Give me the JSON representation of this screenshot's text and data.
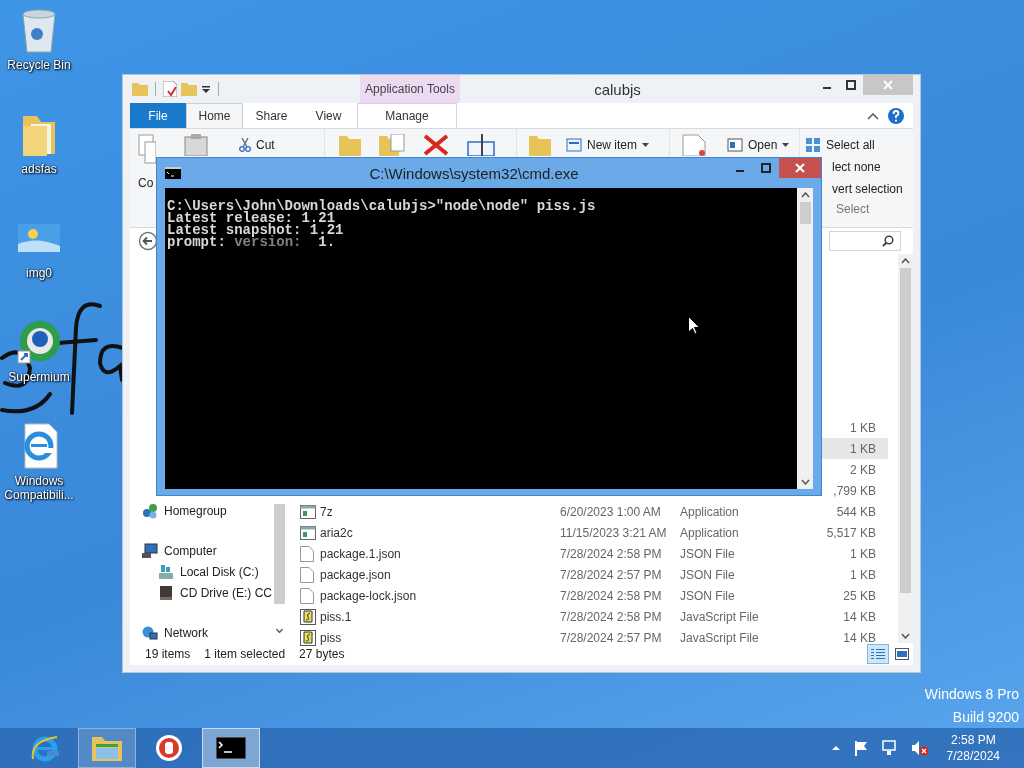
{
  "desktop": {
    "icons": [
      {
        "label": "Recycle Bin",
        "kind": "recycle"
      },
      {
        "label": "adsfas",
        "kind": "folder"
      },
      {
        "label": "img0",
        "kind": "image"
      },
      {
        "label": "Supermium",
        "kind": "browser"
      },
      {
        "label": "Windows Compatibili...",
        "kind": "ie"
      }
    ],
    "watermark": [
      "Windows 8 Pro",
      "Build 9200"
    ]
  },
  "explorer": {
    "title": "calubjs",
    "context_tab": "Application Tools",
    "tabs": [
      {
        "label": "File",
        "kind": "file",
        "selected": false
      },
      {
        "label": "Home",
        "kind": "tab",
        "selected": true
      },
      {
        "label": "Share",
        "kind": "tab",
        "selected": false
      },
      {
        "label": "View",
        "kind": "tab",
        "selected": false
      },
      {
        "label": "Manage",
        "kind": "context",
        "selected": false
      }
    ],
    "ribbon": {
      "copy": "Co",
      "cut": "Cut",
      "new_item": "New item",
      "open": "Open",
      "select_all": "Select all",
      "select_none": "lect none",
      "invert_selection": "vert selection",
      "select_group": "Select"
    },
    "nav": [
      {
        "label": "Homegroup",
        "kind": "homegroup"
      },
      {
        "label": "Computer",
        "kind": "computer",
        "children": [
          {
            "label": "Local Disk (C:)",
            "kind": "disk"
          },
          {
            "label": "CD Drive (E:) CC",
            "kind": "cd"
          }
        ]
      },
      {
        "label": "Network",
        "kind": "network"
      }
    ],
    "files": [
      {
        "size": "1 KB",
        "selected": false
      },
      {
        "size": "1 KB",
        "selected": true
      },
      {
        "size": "2 KB",
        "selected": false
      },
      {
        "size": ",799 KB",
        "selected": false
      },
      {
        "name": "7z",
        "date": "6/20/2023 1:00 AM",
        "type": "Application",
        "size": "544 KB",
        "kind": "app",
        "selected": false
      },
      {
        "name": "aria2c",
        "date": "11/15/2023 3:21 AM",
        "type": "Application",
        "size": "5,517 KB",
        "kind": "app",
        "selected": false
      },
      {
        "name": "package.1.json",
        "date": "7/28/2024 2:58 PM",
        "type": "JSON File",
        "size": "1 KB",
        "kind": "json",
        "selected": false
      },
      {
        "name": "package.json",
        "date": "7/28/2024 2:57 PM",
        "type": "JSON File",
        "size": "1 KB",
        "kind": "json",
        "selected": false
      },
      {
        "name": "package-lock.json",
        "date": "7/28/2024 2:58 PM",
        "type": "JSON File",
        "size": "25 KB",
        "kind": "json",
        "selected": false
      },
      {
        "name": "piss.1",
        "date": "7/28/2024 2:58 PM",
        "type": "JavaScript File",
        "size": "14 KB",
        "kind": "js",
        "selected": false
      },
      {
        "name": "piss",
        "date": "7/28/2024 2:57 PM",
        "type": "JavaScript File",
        "size": "14 KB",
        "kind": "js",
        "selected": false
      }
    ],
    "status": {
      "items": "19 items",
      "selected": "1 item selected",
      "size": "27 bytes"
    },
    "views": [
      {
        "kind": "details",
        "selected": true
      },
      {
        "kind": "tiles",
        "selected": false
      }
    ]
  },
  "cmd": {
    "title": "C:\\Windows\\system32\\cmd.exe",
    "lines": [
      {
        "segments": [
          {
            "text": "C:\\Users\\John\\Downloads\\calubjs>\"node\\node\" piss.js",
            "dim": false
          }
        ]
      },
      {
        "segments": [
          {
            "text": "Latest release: 1.21",
            "dim": false
          }
        ]
      },
      {
        "segments": [
          {
            "text": "Latest snapshot: 1.21",
            "dim": false
          }
        ]
      },
      {
        "segments": [
          {
            "text": "prompt: ",
            "dim": false
          },
          {
            "text": "version:",
            "dim": true
          },
          {
            "text": "  1.",
            "dim": false
          }
        ]
      }
    ]
  },
  "taskbar": {
    "apps": [
      {
        "kind": "ie",
        "running": false,
        "active": false
      },
      {
        "kind": "explorer",
        "running": true,
        "active": false
      },
      {
        "kind": "d-app",
        "running": false,
        "active": false
      },
      {
        "kind": "cmd",
        "running": true,
        "active": true
      }
    ],
    "time": "2:58 PM",
    "date": "7/28/2024"
  }
}
